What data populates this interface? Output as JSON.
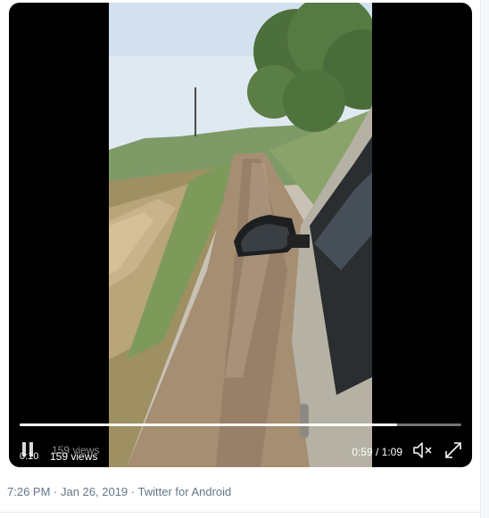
{
  "video": {
    "elapsed": "0:10",
    "views": "159 views",
    "current_time": "0:59",
    "duration": "1:09",
    "time_separator": " / ",
    "progress": 0.855,
    "play_icon": "pause-icon",
    "mute_icon": "muted-speaker-icon",
    "fullscreen_icon": "expand-icon"
  },
  "tweet": {
    "time": "7:26 PM",
    "separator": " · ",
    "date": "Jan 26, 2019",
    "source": "Twitter for Android"
  },
  "colors": {
    "meta_text": "#657786",
    "border": "#e6ecf0"
  }
}
